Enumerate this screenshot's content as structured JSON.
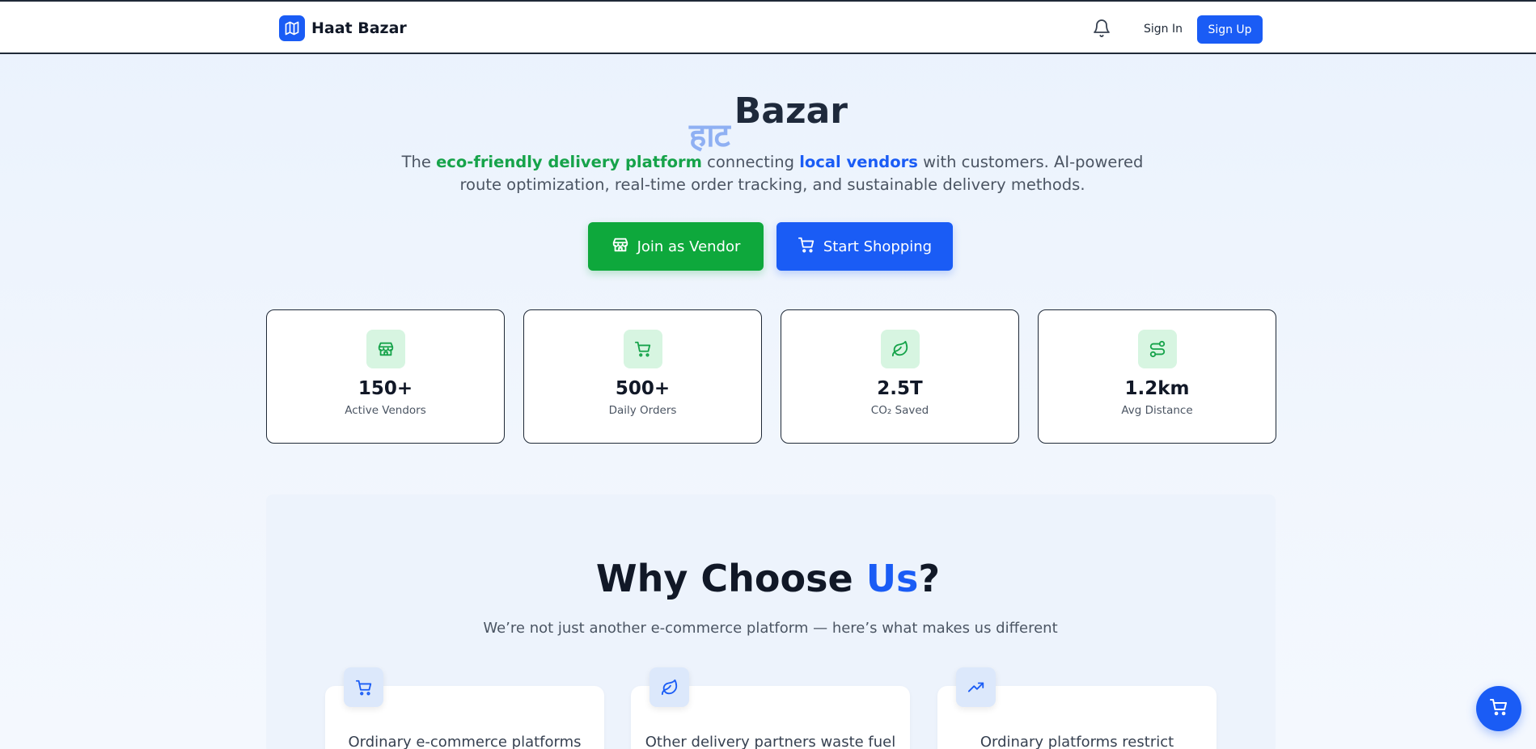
{
  "header": {
    "brand": "Haat Bazar",
    "brand_icon": "map-icon",
    "bell_icon": "bell-icon",
    "sign_in": "Sign In",
    "sign_up": "Sign Up"
  },
  "hero": {
    "title_hindi": "हाट",
    "title_main": "Bazar",
    "subtitle_parts": {
      "p1": "The ",
      "green": "eco-friendly delivery platform",
      "p2": " connecting ",
      "blue": "local vendors",
      "p3": " with customers. AI-powered route optimization, real-time order tracking, and sustainable delivery methods."
    },
    "vendor_button": "Join as Vendor",
    "shop_button": "Start Shopping"
  },
  "stats": [
    {
      "icon": "store-icon",
      "value": "150+",
      "label": "Active Vendors"
    },
    {
      "icon": "cart-icon",
      "value": "500+",
      "label": "Daily Orders"
    },
    {
      "icon": "leaf-icon",
      "value": "2.5T",
      "label": "CO₂ Saved"
    },
    {
      "icon": "route-icon",
      "value": "1.2km",
      "label": "Avg Distance"
    }
  ],
  "why": {
    "title_main": "Why Choose ",
    "title_accent": "Us",
    "title_end": "?",
    "subtitle": "We’re not just another e-commerce platform — here’s what makes us different",
    "features": [
      {
        "icon": "cart-icon",
        "text": "Ordinary e-commerce platforms"
      },
      {
        "icon": "leaf-icon",
        "text": "Other delivery partners waste fuel"
      },
      {
        "icon": "trending-up-icon",
        "text": "Ordinary platforms restrict"
      }
    ]
  },
  "fab": {
    "icon": "cart-icon"
  },
  "colors": {
    "brand_blue": "#1a5cf5",
    "brand_green": "#0ea83c",
    "hindi_blue": "#8fb0f3",
    "stat_icon_bg": "#d7f5e1"
  }
}
